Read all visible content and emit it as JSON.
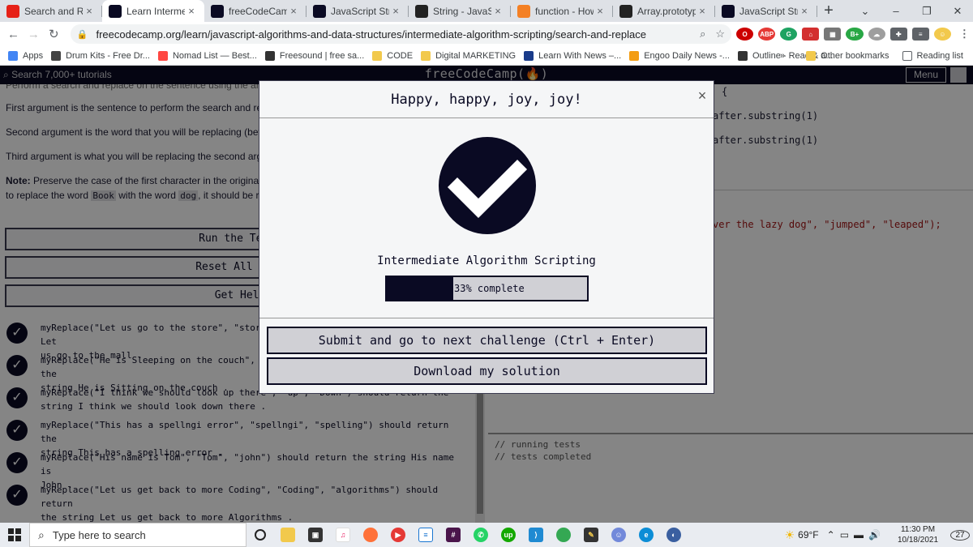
{
  "browser": {
    "tabs": [
      {
        "title": "Search and Replac",
        "color": "#e62117",
        "active": false
      },
      {
        "title": "Learn Intermediat",
        "color": "#0a0a23",
        "active": true
      },
      {
        "title": "freeCodeCamp Ch",
        "color": "#0a0a23",
        "active": false
      },
      {
        "title": "JavaScript String.p",
        "color": "#0a0a23",
        "active": false
      },
      {
        "title": "String - JavaScript",
        "color": "#222222",
        "active": false
      },
      {
        "title": "function - How to",
        "color": "#f48024",
        "active": false
      },
      {
        "title": "Array.prototype.sl",
        "color": "#222222",
        "active": false
      },
      {
        "title": "JavaScript String.p",
        "color": "#0a0a23",
        "active": false
      }
    ],
    "new_tab_icon": "+",
    "url": "freecodecamp.org/learn/javascript-algorithms-and-data-structures/intermediate-algorithm-scripting/search-and-replace",
    "bookmarks": [
      {
        "label": "Apps",
        "color": "#4285f4"
      },
      {
        "label": "Drum Kits - Free Dr...",
        "color": "#444444"
      },
      {
        "label": "Nomad List — Best...",
        "color": "#ff4742"
      },
      {
        "label": "Freesound | free sa...",
        "color": "#333333"
      },
      {
        "label": "CODE",
        "color": "#f2c94c"
      },
      {
        "label": "Digital MARKETING",
        "color": "#f2c94c"
      },
      {
        "label": "Learn With News –...",
        "color": "#1a3b8a"
      },
      {
        "label": "Engoo Daily News -...",
        "color": "#f39c12"
      },
      {
        "label": "Outline - Read & a...",
        "color": "#333333"
      }
    ],
    "bookmarks_more": "»",
    "other_bookmarks": "Other bookmarks",
    "reading_list": "Reading list"
  },
  "fcc_nav": {
    "search_placeholder": "Search 7,000+ tutorials",
    "logo": "freeCodeCamp(🔥)",
    "menu": "Menu"
  },
  "lesson": {
    "top_cut": "Perform a search and replace on the sentence using the arguments provided and return the new sentence.",
    "line1": "First argument is the sentence to perform the search and replace on.",
    "line2": "Second argument is the word that you will be replacing (before).",
    "line3": "Third argument is what you will be replacing the second argument with (after).",
    "note_label": "Note:",
    "note_text": " Preserve the case of the first character in the original word when you are replacing it. For example if you mean",
    "note2_pre": "to replace the word ",
    "note2_code1": "Book",
    "note2_mid": " with the word ",
    "note2_code2": "dog",
    "note2_post": ", it should be replaced as Dog"
  },
  "buttons": {
    "run": "Run the Tests",
    "reset": "Reset All Code",
    "help": "Get Help"
  },
  "tests": [
    {
      "line1": "myReplace(\"Let us go to the store\", \"store\", \"mall\") should return the string Let",
      "line2": "us go to the mall ."
    },
    {
      "line1": "myReplace(\"He is Sleeping on the couch\", \"Sleeping\", \"sitting\") should return the",
      "line2": "string He is Sitting on the couch ."
    },
    {
      "line1": "myReplace(\"I think we should look up there\", \"up\", \"Down\") should return the",
      "line2": "string I think we should look down there ."
    },
    {
      "line1": "myReplace(\"This has a spellngi error\", \"spellngi\", \"spelling\") should return the",
      "line2": "string This has a spelling error ."
    },
    {
      "line1": "myReplace(\"His name is Tom\", \"Tom\", \"john\") should return the string His name is",
      "line2": "John ."
    },
    {
      "line1": "myReplace(\"Let us get back to more Coding\", \"Coding\", \"algorithms\") should return",
      "line2": "the string Let us get back to more Algorithms ."
    }
  ],
  "editor": {
    "brace": "{",
    "sub1": "after.substring(1)",
    "sub2": "after.substring(1)",
    "call_tail": "ver the lazy dog\", \"jumped\", \"leaped\");"
  },
  "console": {
    "line1": "// running tests",
    "line2": "// tests completed"
  },
  "modal": {
    "title": "Happy, happy, joy, joy!",
    "close": "×",
    "block": "Intermediate Algorithm Scripting",
    "progress_percent": 33,
    "progress_text": "33% complete",
    "submit": "Submit and go to next challenge (Ctrl + Enter)",
    "download": "Download my solution"
  },
  "taskbar": {
    "search_placeholder": "Type here to search",
    "weather": "69°F",
    "time": "11:30 PM",
    "date": "10/18/2021",
    "notifications": "27"
  },
  "colors": {
    "fcc_dark": "#0a0a23",
    "modal_bg": "#f5f6f7",
    "button_bg": "#d0d0d5"
  }
}
